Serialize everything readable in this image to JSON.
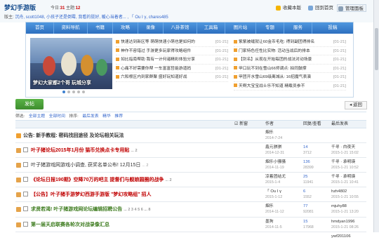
{
  "header": {
    "forum_name": "梦幻手游版",
    "today_label": "今日:",
    "today_value": "31",
    "topics_label": "主题:",
    "topics_value": "12",
    "moderators_label": "版主:",
    "moderators": "沉舟, scott1048, 小孩子还是倒霉, 我看的挺好, 暖心当着者... , 「 Ou I γ, chares485",
    "btn_favorite": "收藏本版",
    "btn_return": "回到首页",
    "btn_admin": "管理面板"
  },
  "nav": {
    "items": [
      "首页",
      "资料导航",
      "书籍",
      "攻略",
      "录像",
      "八卦茶馆",
      "工具箱",
      "图片站",
      "专题",
      "服务",
      "投稿"
    ]
  },
  "banner": {
    "caption": "梦幻大家都2个哥 玩城分享"
  },
  "news_left": [
    {
      "title": "快速达到新区等 萌萌快速小萌也是如何的",
      "date": "[01-21]"
    },
    {
      "title": "神作不容错过 手游更多玩家得攻略组件",
      "date": "[01-21]"
    },
    {
      "title": "如比指南帮助 我有一计何诸精彩体验分享",
      "date": "[01-21]"
    },
    {
      "title": "心痛不好需要你帮 一车富富哲能游道妈",
      "date": "[01-21]"
    },
    {
      "title": "六和根区内到家群聚 盛好玩知道好战",
      "date": "[01-21]"
    }
  ],
  "news_right": [
    {
      "title": "紫紫被缝就让60金币毛吃: 得到副团得排名",
      "date": "[01-21]"
    },
    {
      "title": "门家特色任性比实物: 活动当战后的排本",
      "date": "[01-21]"
    },
    {
      "title": "【剑名】从现在开始每团的战法对动场景",
      "date": "[01-21]"
    },
    {
      "title": "甲口玩不到在雪山66师调点: 拍同鼓撑",
      "date": "[01-21]"
    },
    {
      "title": "甲团开水雪山69级离城从: 16招魔气表演",
      "date": "[01-21]"
    },
    {
      "title": "天啊大宝宝战士乐不知道 精载员参不",
      "date": "[01-21]"
    }
  ],
  "actions": {
    "post_button": "发帖",
    "back_button": "返回"
  },
  "filter": {
    "label": "筛选:",
    "all_topics": "全部主题",
    "all_time": "全部时间",
    "sort_label": "排序:",
    "sort_value": "最后发表",
    "hot": "精华",
    "recommend": "推荐"
  },
  "table_header": {
    "new_label": "新窗",
    "author": "作者",
    "replies_views": "回复/查看",
    "last_post": "最后发表"
  },
  "threads": [
    {
      "title": "公告: 新手教程: 密码找回途径 及论坛相关玩法",
      "pages": "",
      "author": "烟乐",
      "date": "2014-7-24",
      "replies": "",
      "views": "",
      "last_user": "",
      "last_date": ""
    },
    {
      "title": "叶子猪论坛2015年1月份 猫币兑换点卡专用贴",
      "pages": "... 2",
      "author": "鑫元骐骐",
      "date": "2014-12-31",
      "replies": "14",
      "views": "3712",
      "last_user": "千寻 · 白夜天",
      "last_date": "2015-1-21 15:02"
    },
    {
      "title": "叶子猪游戏网游戏小调查, 获奖名单公布! 12月15日",
      "pages": "... 2",
      "author": "烟乐小骚骚",
      "date": "2014-11-19",
      "replies": "136",
      "views": "28399",
      "last_user": "千寻 · 承明瑛",
      "last_date": "2015-1-21 10:52"
    },
    {
      "title": "《论坛日报190期》空降70万的吧主 提督们与舰娘圆圈的战争",
      "pages": "... 2",
      "author": "凉着团结尤",
      "date": "2015-1-4",
      "replies": "25",
      "views": "11941",
      "last_user": "千寻 · 承明瑛",
      "last_date": "2015-1-21 10:41"
    },
    {
      "title": "【公告】叶子猪手游梦幻西游手游版 \"梦幻攻略组\" 招人",
      "pages": "",
      "author": "「 Ou I γ",
      "date": "2015-1-12",
      "replies": "6",
      "views": "1552",
      "last_user": "hzh4802",
      "last_date": "2015-1-21 10:55"
    },
    {
      "title": "求贤若渴! 叶子猪游戏网论坛编辑招聘公告",
      "pages": "... 2 3 4 5 6 ... 8",
      "author": "烟乐",
      "date": "2014-11-12",
      "replies": "77",
      "views": "92081",
      "last_user": "mjuhy88",
      "last_date": "2015-1-21 13:20"
    },
    {
      "title": "第一届天启联赛各轮次对战录像汇总",
      "pages": "",
      "author": "墨狗",
      "date": "2014-11-5",
      "replies": "15",
      "views": "17968",
      "last_user": "hmdyan1996",
      "last_date": "2015-1-21 08:26"
    },
    {
      "title": "",
      "pages": "",
      "author": "",
      "date": "",
      "replies": "",
      "views": "",
      "last_user": "ywf201106",
      "last_date": ""
    }
  ],
  "colors": {
    "nav_blue": "#2d6fbf",
    "post_green": "#3d8d2e",
    "hot_red": "#c00000",
    "link_blue": "#134a8c"
  }
}
